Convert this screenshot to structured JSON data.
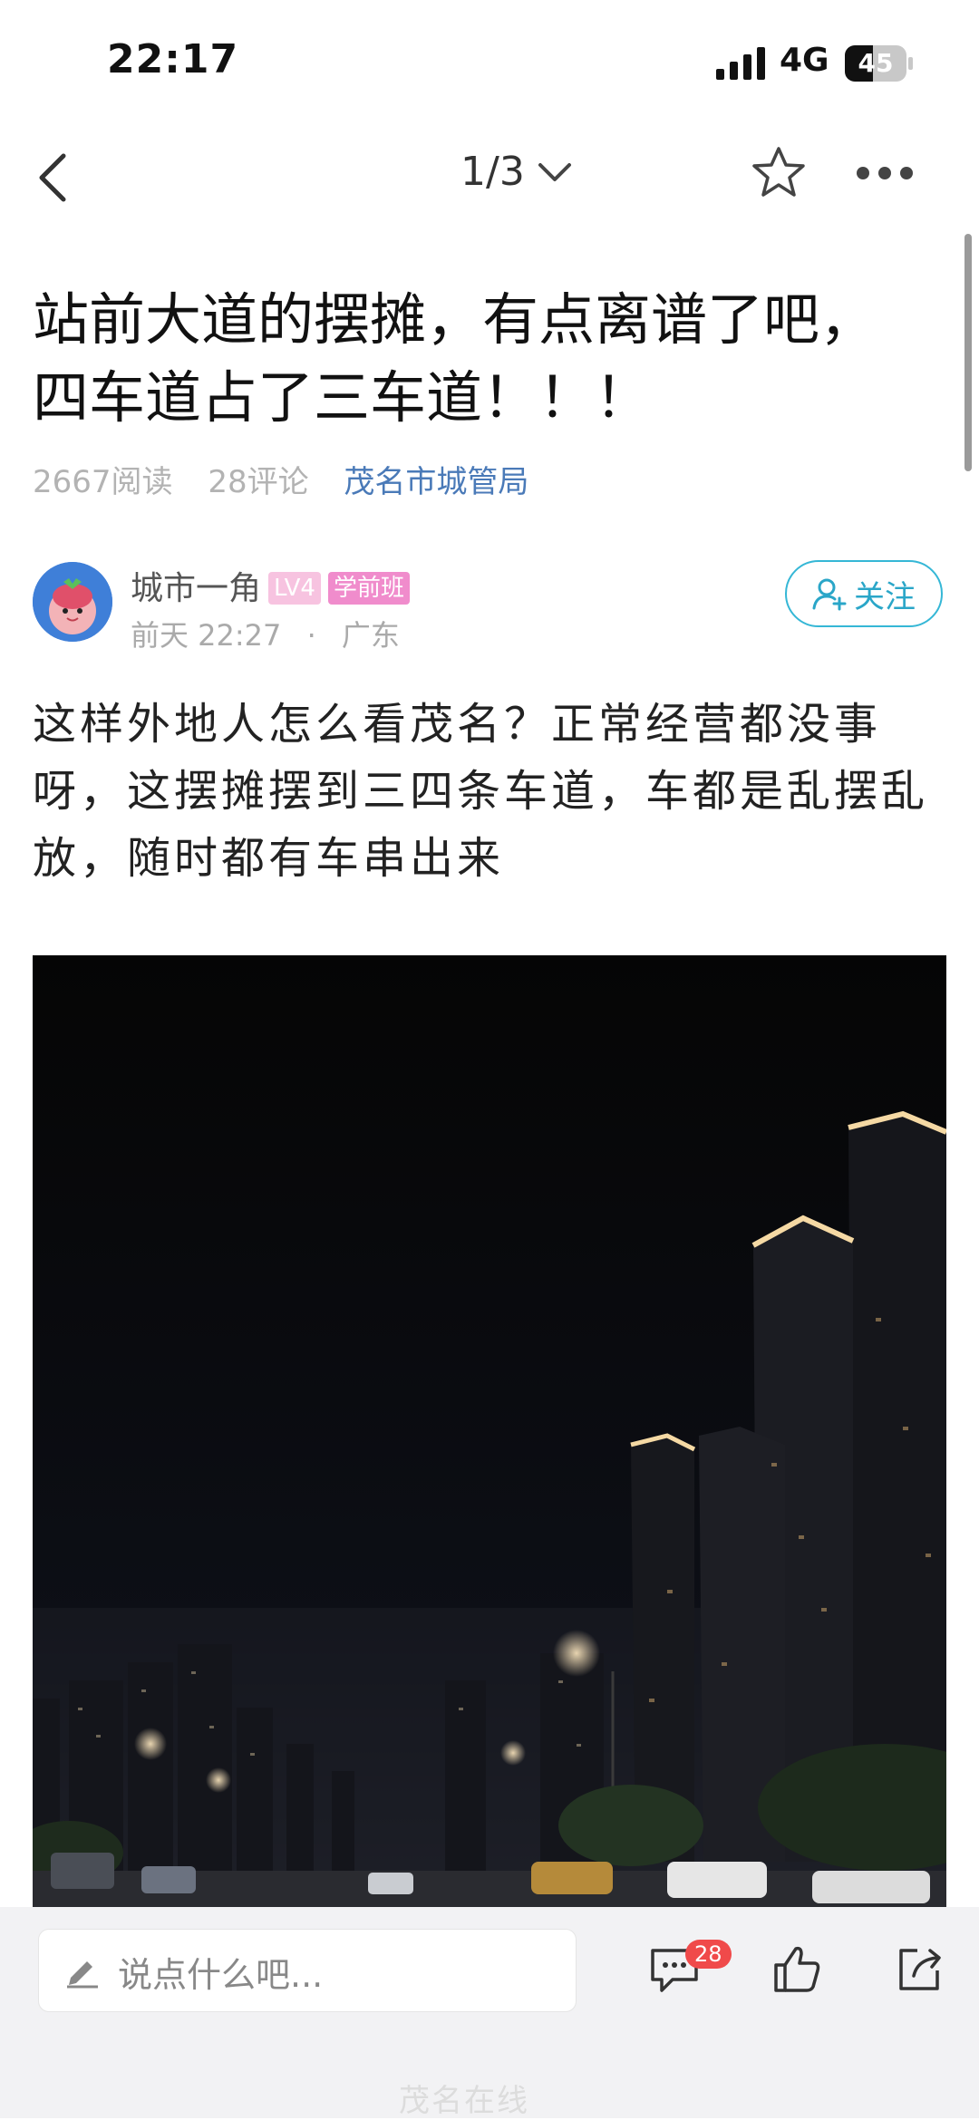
{
  "status_bar": {
    "time": "22:17",
    "network": "4G",
    "battery": "45"
  },
  "nav": {
    "pager": "1/3"
  },
  "post": {
    "title_line1": "站前大道的摆摊，有点离谱了吧，",
    "title_line2": "四车道占了三车道！！！",
    "reads": "2667阅读",
    "comments": "28评论",
    "department": "茂名市城管局",
    "author": "城市一角",
    "level_badge": "LV4",
    "class_badge": "学前班",
    "time": "前天 22:27",
    "location": "广东",
    "follow_label": "关注",
    "body_line1": "这样外地人怎么看茂名？正常经营都没事",
    "body_line2": "呀，这摆摊摆到三四条车道，车都是乱摆乱",
    "body_line3": "放，随时都有车串出来"
  },
  "bottom_bar": {
    "comment_placeholder": "说点什么吧...",
    "comment_count": "28"
  },
  "watermark": "茂名在线",
  "colors": {
    "accent": "#35b7d6",
    "dept_link": "#4a7ab8",
    "badge_red": "#f04a4a",
    "badge_pink": "#f08ccc"
  }
}
